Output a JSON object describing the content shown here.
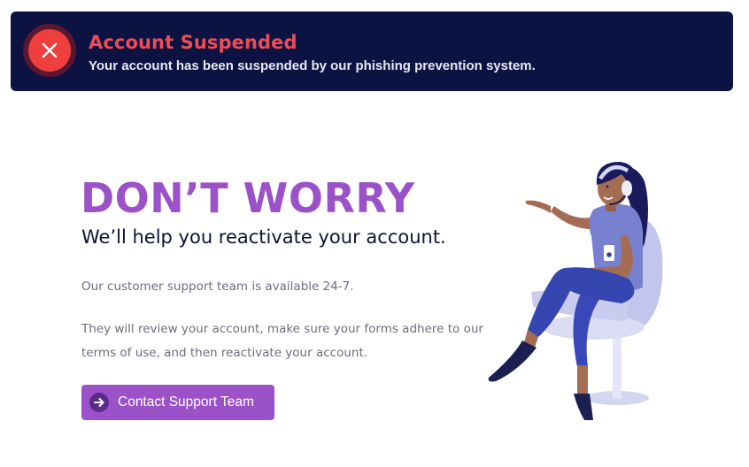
{
  "banner": {
    "title": "Account Suspended",
    "message": "Your account has been suspended by our phishing prevention system.",
    "icon": "close-icon",
    "background_color": "#0c1242",
    "accent_color": "#ef3f3c"
  },
  "main": {
    "headline": "DON’T WORRY",
    "subheadline": "We’ll help you reactivate your account.",
    "paragraph_1": "Our customer support team is available 24-7.",
    "paragraph_2": "They will review your account, make sure your forms adhere to our terms of use, and then reactivate your account.",
    "accent_color": "#9b52c8"
  },
  "cta": {
    "label": "Contact Support Team",
    "icon": "arrow-right-icon"
  },
  "illustration": {
    "subject": "support-agent-illustration"
  }
}
